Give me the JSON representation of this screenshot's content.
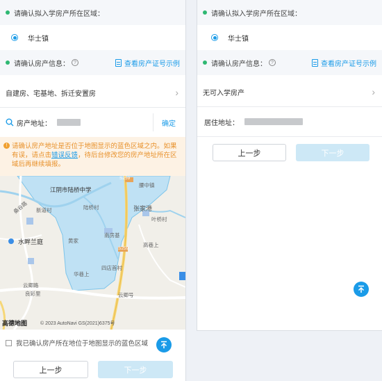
{
  "left": {
    "area_prompt": "请确认拟入学房产所在区域：",
    "area_option": "华士镇",
    "property_prompt": "请确认房产信息：",
    "sample_link": "查看房产证号示例",
    "property_type": "自建房、宅基地、拆迁安置房",
    "address_label": "房产地址：",
    "confirm_label": "确定",
    "warning_pre": "请确认房产地址是否位于地图显示的蓝色区域之内。如果有误，请点击",
    "warning_link": "错误反馈",
    "warning_post": "，待后台修改您的房产地址所在区域后再继续填报。",
    "map": {
      "labels": {
        "school": "江阴市陆桥中学",
        "village_lu": "陆桥村",
        "village_xindao": "新道村",
        "village_zhangjia": "张家港",
        "village_yeqiao": "叶桥村",
        "village_jiaoxin": "腰中镇",
        "shuipan": "水畔兰庭",
        "nanfang": "南房基",
        "gaoshan": "高巷上",
        "huangjia": "黄家",
        "xiaqiao": "华巷上",
        "sifang": "四店首村",
        "yunyu": "云卿路",
        "yunyu2": "云卿号",
        "liangcai": "良彩里",
        "sangu": "桑谷路",
        "road1": "S259",
        "road2": "S259"
      },
      "logo": "高德地图",
      "copyright": "© 2023 AutoNavi GS(2021)6375号"
    },
    "confirm_checkbox": "我已确认房产所在地位于地图显示的蓝色区域",
    "prev_button": "上一步",
    "next_button": "下一步"
  },
  "right": {
    "area_prompt": "请确认拟入学房产所在区域：",
    "area_option": "华士镇",
    "property_prompt": "请确认房产信息：",
    "sample_link": "查看房产证号示例",
    "property_type": "无可入学房产",
    "address_label": "居住地址：",
    "prev_button": "上一步",
    "next_button": "下一步"
  },
  "colors": {
    "accent": "#1a9be8",
    "green_dot": "#2eb872",
    "warning_text": "#e8912b",
    "map_area": "#b9dff3"
  }
}
